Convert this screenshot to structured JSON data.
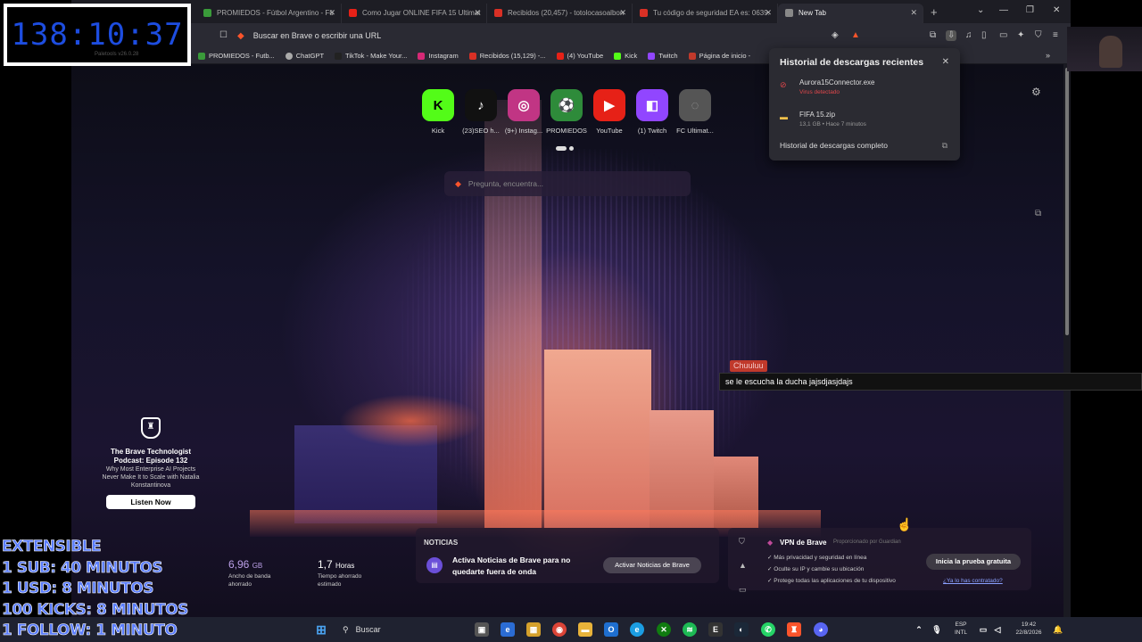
{
  "timer": {
    "value": "138:10:37",
    "sub": "Paletools v26.0.28"
  },
  "extensible": {
    "lines": [
      "EXTENSIBLE",
      "1 SUB: 40 MINUTOS",
      "1 USD: 8 MINUTOS",
      "100 KICKS: 8 MINUTOS",
      "1 FOLLOW: 1 MINUTO"
    ]
  },
  "tabs": [
    {
      "label": "PROMIEDOS - Fútbol Argentino - Fú",
      "color": "#3a9b3a"
    },
    {
      "label": "Como Jugar ONLINE FIFA 15 Ultimat",
      "color": "#e62117"
    },
    {
      "label": "Recibidos (20,457) - totolocasoalbon",
      "color": "#d93025"
    },
    {
      "label": "Tu código de seguridad EA es: 0639.",
      "color": "#d93025"
    },
    {
      "label": "New Tab",
      "color": "#888888"
    }
  ],
  "toolbar": {
    "url_placeholder": "Buscar en Brave o escribir una URL"
  },
  "bookmarks": [
    {
      "label": "PROMIEDOS - Futb...",
      "color": "#3a9b3a"
    },
    {
      "label": "ChatGPT",
      "color": "#aaaaaa"
    },
    {
      "label": "TikTok - Make Your...",
      "color": "#222222"
    },
    {
      "label": "Instagram",
      "color": "#d62976"
    },
    {
      "label": "Recibidos (15,129) -...",
      "color": "#d93025"
    },
    {
      "label": "(4) YouTube",
      "color": "#e62117"
    },
    {
      "label": "Kick",
      "color": "#53fc18"
    },
    {
      "label": "Twitch",
      "color": "#9146ff"
    },
    {
      "label": "Página de inicio -",
      "color": "#c0392b"
    }
  ],
  "shortcuts": [
    {
      "label": "Kick",
      "glyph": "K",
      "bg": "#53fc18",
      "fg": "#000000"
    },
    {
      "label": "(23)SEO h...",
      "glyph": "♪",
      "bg": "#111111",
      "fg": "#ffffff"
    },
    {
      "label": "(9+) Instag...",
      "glyph": "◎",
      "bg": "#c13584",
      "fg": "#ffffff"
    },
    {
      "label": "PROMIEDOS",
      "glyph": "⚽",
      "bg": "#2e8b3a",
      "fg": "#ffffff"
    },
    {
      "label": "YouTube",
      "glyph": "▶",
      "bg": "#e62117",
      "fg": "#ffffff"
    },
    {
      "label": "(1) Twitch",
      "glyph": "◧",
      "bg": "#9146ff",
      "fg": "#ffffff"
    },
    {
      "label": "FC Ultimat...",
      "glyph": "◌",
      "bg": "#555555",
      "fg": "#999999"
    }
  ],
  "search": {
    "placeholder": "Pregunta, encuentra..."
  },
  "downloads": {
    "title": "Historial de descargas recientes",
    "items": [
      {
        "name": "Aurora15Connector.exe",
        "status": "Virus detectado",
        "status_color": "#e0474b"
      },
      {
        "name": "FIFA 15.zip",
        "status": "13,1 GB • Hace 7 minutos",
        "status_color": "#999999"
      }
    ],
    "full_history": "Historial de descargas completo"
  },
  "podcast": {
    "title": "The Brave Technologist Podcast: Episode 132",
    "description": "Why Most Enterprise AI Projects Never Make It to Scale with Natalia Konstantinova",
    "button": "Listen Now"
  },
  "stats": [
    {
      "value": "6,96",
      "unit": "GB",
      "label": "Ancho de banda ahorrado"
    },
    {
      "value": "1,7",
      "unit": "Horas",
      "label": "Tiempo ahorrado estimado"
    }
  ],
  "news": {
    "heading": "NOTICIAS",
    "text": "Activa Noticias de Brave para no quedarte fuera de onda",
    "button": "Activar Noticias de Brave"
  },
  "vpn": {
    "title": "VPN de Brave",
    "powered": "Proporcionado por Guardian",
    "features": [
      "Más privacidad y seguridad en línea",
      "Oculte su IP y cambie su ubicación",
      "Protege todas las aplicaciones de tu dispositivo"
    ],
    "button": "Inicia la prueba gratuita",
    "link": "¿Ya lo has contratado?"
  },
  "chat": {
    "user": "Chuuluu",
    "message": "se le escucha la ducha jajsdjasjdajs"
  },
  "taskbar": {
    "search": "Buscar",
    "lang_top": "ESP",
    "lang_bottom": "INTL",
    "time": "19:42",
    "date": "22/8/2026"
  }
}
